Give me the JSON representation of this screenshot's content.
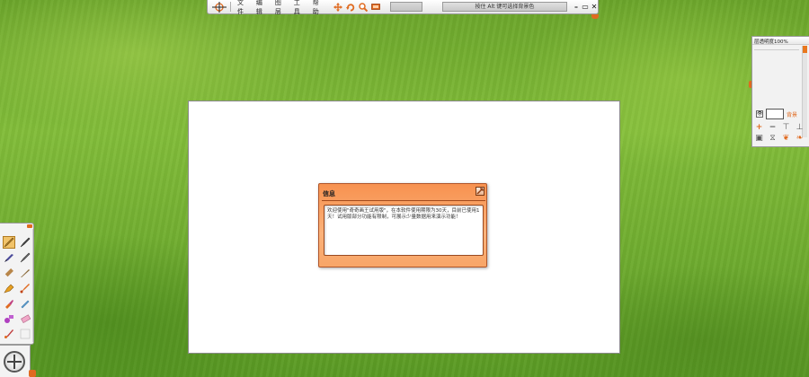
{
  "topbar": {
    "logo_icon": "compass-logo-icon",
    "menu": [
      {
        "label": "文件"
      },
      {
        "label": "编辑"
      },
      {
        "label": "图层"
      },
      {
        "label": "工具"
      },
      {
        "label": "帮助"
      }
    ],
    "tool_icons": [
      "move-icon",
      "rotate-icon",
      "zoom-icon",
      "screen-icon"
    ],
    "hint": "按住 Alt 键可选择背景色",
    "window_controls": [
      "minimize-icon",
      "restore-icon",
      "close-icon"
    ]
  },
  "layers_panel": {
    "title": "层透明度100%",
    "layer_label": "背景",
    "tool_icons": [
      "add-layer-icon",
      "delete-layer-icon",
      "merge-layer-icon",
      "lock-layer-icon",
      "layer-settings-icon",
      "flip-icon",
      "paint-icon",
      "fill-icon"
    ]
  },
  "dialog": {
    "title": "信息",
    "message": "欢迎使用\"奇奇画王试用版\"，在本软件使用期限为30天，目前已使用1天！试用版部分功能有限制，可展示少量数据用来演示功能！"
  },
  "toolbox": {
    "tools": [
      "pencil-tool-icon",
      "pen-tool-icon",
      "brush-tool-icon",
      "marker-tool-icon",
      "crayon-tool-icon",
      "quill-tool-icon",
      "spray-tool-icon",
      "paint-brush-tool-icon",
      "dropper-tool-icon",
      "water-tool-icon",
      "stamp-tool-icon",
      "eraser-tool-icon",
      "smudge-tool-icon",
      "blank-tool-icon"
    ]
  },
  "colors": {
    "accent": "#e06a20",
    "dialog_orange": "#f79250",
    "background_green": "#74b032"
  }
}
